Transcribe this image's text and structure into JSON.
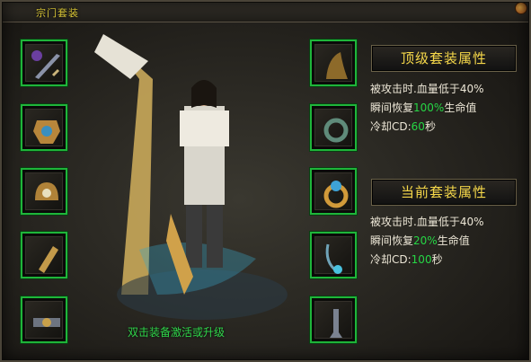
{
  "window": {
    "tab_title": "宗门套装"
  },
  "hint": "双击装备激活或升级",
  "top_set": {
    "heading": "顶级套装属性",
    "line1": "被攻击时.血量低于40%",
    "line2_prefix": "瞬间恢复",
    "line2_value": "100%",
    "line2_suffix": "生命值",
    "line3_prefix": "冷却CD:",
    "line3_value": "60",
    "line3_suffix": "秒"
  },
  "current_set": {
    "heading": "当前套装属性",
    "line1": "被攻击时.血量低于40%",
    "line2_prefix": "瞬间恢复",
    "line2_value": "20%",
    "line2_suffix": "生命值",
    "line3_prefix": "冷却CD:",
    "line3_value": "100",
    "line3_suffix": "秒"
  },
  "slots_left": [
    {
      "icon": "weapon-icon"
    },
    {
      "icon": "armor-icon"
    },
    {
      "icon": "helmet-icon"
    },
    {
      "icon": "bracer-icon"
    },
    {
      "icon": "belt-icon"
    }
  ],
  "slots_right": [
    {
      "icon": "medal-icon"
    },
    {
      "icon": "bracelet-icon"
    },
    {
      "icon": "ring-icon"
    },
    {
      "icon": "necklace-icon"
    },
    {
      "icon": "boots-icon"
    }
  ],
  "colors": {
    "slot_border": "#1fb53a",
    "accent_text": "#f6d84a",
    "value_green": "#26d645"
  }
}
